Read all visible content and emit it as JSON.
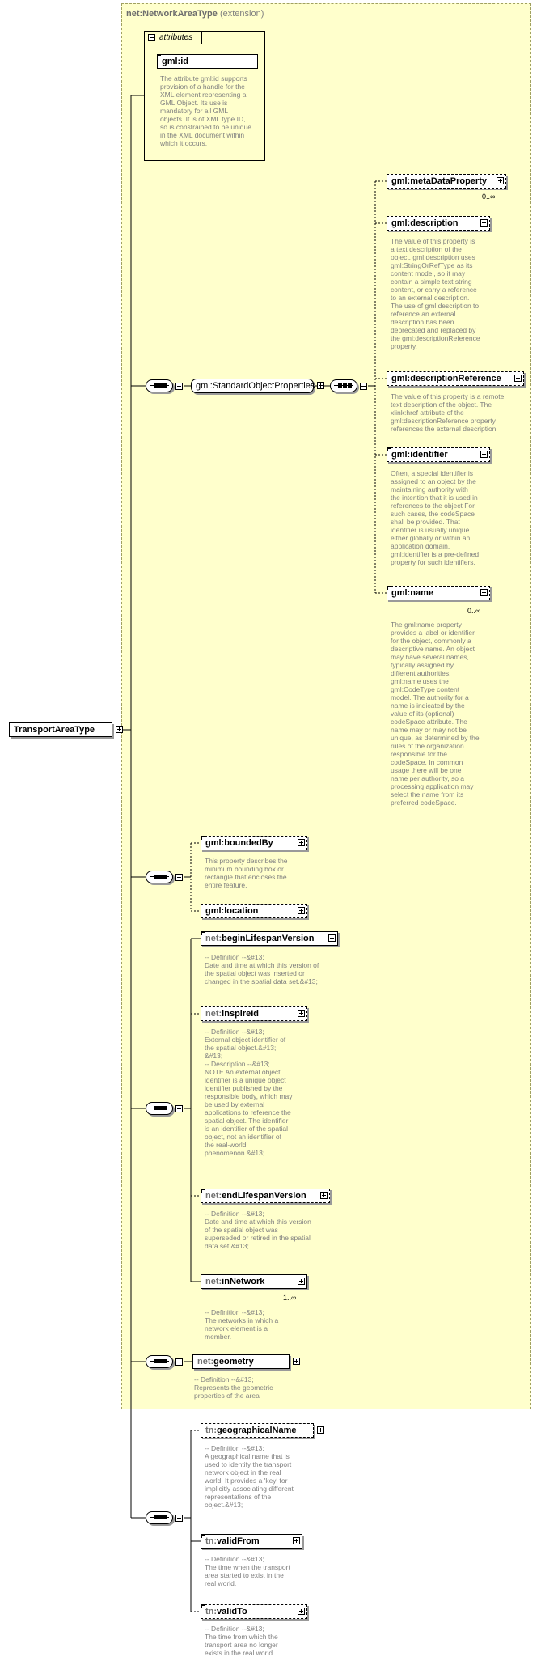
{
  "extension": {
    "prefix": "net:",
    "name": "NetworkAreaType",
    "suffix": " (extension)"
  },
  "root": {
    "name": "TransportAreaType"
  },
  "attributes": {
    "tab_label": "attributes",
    "id_prefix": "gml:",
    "id_name": "id",
    "id_desc": "The attribute gml:id supports\nprovision of a handle for the\nXML element representing a\nGML Object. Its use is\nmandatory for all GML\nobjects. It is of XML type ID,\nso is constrained to be unique\nin the XML document within\nwhich it occurs."
  },
  "group": {
    "prefix": "gml:",
    "name": "StandardObjectProperties"
  },
  "elements": {
    "metaDataProperty": {
      "prefix": "gml:",
      "name": "metaDataProperty",
      "mult": "0..∞"
    },
    "description": {
      "prefix": "gml:",
      "name": "description",
      "desc": "The value of this property is\na text description of the\nobject. gml:description uses\ngml:StringOrRefType as its\ncontent model, so it may\ncontain a simple text string\ncontent, or carry a reference\nto an external description.\nThe use of gml:description to\nreference an external\ndescription has been\ndeprecated and replaced by\nthe gml:descriptionReference\nproperty."
    },
    "descriptionReference": {
      "prefix": "gml:",
      "name": "descriptionReference",
      "desc": "The value of this property is a remote\ntext description of the object. The\nxlink:href attribute of the\ngml:descriptionReference property\nreferences the external description."
    },
    "identifier": {
      "prefix": "gml:",
      "name": "identifier",
      "desc": "Often, a special identifier is\nassigned to an object by the\nmaintaining authority with\nthe intention that it is used in\nreferences to the object For\nsuch cases, the codeSpace\nshall be provided. That\nidentifier is usually unique\neither globally or within an\napplication domain.\ngml:identifier is a pre-defined\nproperty for such identifiers."
    },
    "name": {
      "prefix": "gml:",
      "name": "name",
      "mult": "0..∞",
      "desc": "The gml:name property\nprovides a label or identifier\nfor the object, commonly a\ndescriptive name. An object\nmay have several names,\ntypically assigned by\ndifferent authorities.\ngml:name uses the\ngml:CodeType content\nmodel.  The authority for a\nname is indicated by the\nvalue of its (optional)\ncodeSpace attribute.  The\nname may or may not be\nunique, as determined by the\nrules of the organization\nresponsible for the\ncodeSpace.  In common\nusage there will be one\nname per authority, so a\nprocessing application may\nselect the name from its\npreferred codeSpace."
    },
    "boundedBy": {
      "prefix": "gml:",
      "name": "boundedBy",
      "desc": "This property describes the\nminimum bounding box or\nrectangle that encloses the\nentire feature."
    },
    "location": {
      "prefix": "gml:",
      "name": "location"
    },
    "beginLifespanVersion": {
      "prefix": "net:",
      "name": "beginLifespanVersion",
      "desc": "-- Definition --&#13;\nDate and time at which this version of\nthe spatial object was inserted or\nchanged in the spatial data set.&#13;"
    },
    "inspireId": {
      "prefix": "net:",
      "name": "inspireId",
      "desc": "-- Definition --&#13;\nExternal object identifier of\nthe spatial object.&#13;\n&#13;\n-- Description --&#13;\nNOTE An external object\nidentifier is a unique object\nidentifier published by the\nresponsible body, which may\nbe used by external\napplications to reference the\nspatial object. The identifier\nis an identifier of the spatial\nobject, not an identifier of\nthe real-world\nphenomenon.&#13;"
    },
    "endLifespanVersion": {
      "prefix": "net:",
      "name": "endLifespanVersion",
      "desc": "-- Definition --&#13;\nDate and time at which this version\nof the spatial object was\nsuperseded or retired in the spatial\ndata set.&#13;"
    },
    "inNetwork": {
      "prefix": "net:",
      "name": "inNetwork",
      "mult": "1..∞",
      "desc": "-- Definition --&#13;\nThe networks in which a\nnetwork element is a\nmember."
    },
    "geometry": {
      "prefix": "net:",
      "name": "geometry",
      "desc": "-- Definition --&#13;\nRepresents the geometric\nproperties of the area"
    },
    "geographicalName": {
      "prefix": "tn:",
      "name": "geographicalName",
      "desc": "-- Definition --&#13;\nA geographical name that is\nused to identify the transport\nnetwork object in the real\nworld. It provides a 'key' for\nimplicitly associating different\nrepresentations of the\nobject.&#13;"
    },
    "validFrom": {
      "prefix": "tn:",
      "name": "validFrom",
      "desc": "-- Definition --&#13;\nThe time when the transport\narea started to exist in the\nreal world."
    },
    "validTo": {
      "prefix": "tn:",
      "name": "validTo",
      "desc": "-- Definition --&#13;\nThe time from which the\ntransport area no longer\nexists in the real world."
    }
  },
  "colors": {
    "extension_bg": "#ffffcc",
    "description_text": "#7f7f7f",
    "prefix_text": "#707070"
  }
}
